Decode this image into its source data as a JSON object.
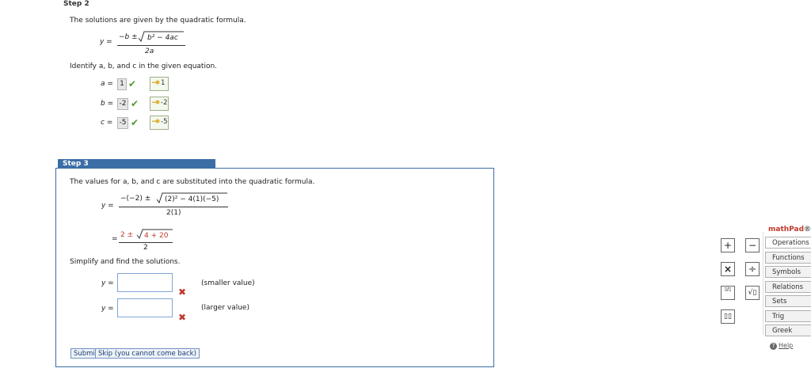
{
  "step2": {
    "title": "Step 2",
    "intro": "The solutions are given by the quadratic formula.",
    "formula": {
      "lhs": "y =",
      "num_minus": "−b ±",
      "num_rad": "b² − 4ac",
      "den": "2a"
    },
    "identify": "Identify a, b, and c in the given equation.",
    "rows": [
      {
        "var": "a =",
        "entered": "1",
        "correct": "1"
      },
      {
        "var": "b =",
        "entered": "-2",
        "correct": "-2"
      },
      {
        "var": "c =",
        "entered": "-5",
        "correct": "-5"
      }
    ]
  },
  "step3": {
    "title": "Step 3",
    "intro": "The values for a, b, and c are substituted into the quadratic formula.",
    "sub1": {
      "lhs": "y =",
      "num_a": "−(−2) ±",
      "num_rad": "(2)² − 4(1)(−5)",
      "den": "2(1)"
    },
    "sub2": {
      "lhs": "=",
      "num_a": "2 ±",
      "num_rad": "4 + 20",
      "den": "2"
    },
    "simplify": "Simplify and find the solutions.",
    "answers": [
      {
        "lhs": "y =",
        "value": "",
        "note": "(smaller value)"
      },
      {
        "lhs": "y =",
        "value": "",
        "note": "(larger value)"
      }
    ],
    "submit_label": "Submit",
    "skip_label": "Skip (you cannot come back)"
  },
  "mathpad": {
    "logo_main": "mathPad",
    "logo_suffix": "®",
    "buttons": [
      "+",
      "−",
      "×",
      "÷",
      "▯/▯",
      "√▯",
      "▯▯"
    ],
    "tabs": [
      "Operations",
      "Functions",
      "Symbols",
      "Relations",
      "Sets",
      "Trig",
      "Greek"
    ],
    "help": "Help"
  },
  "colors": {
    "accent": "#3a6ea5",
    "check": "#4e9a34",
    "error": "#c0392b"
  }
}
